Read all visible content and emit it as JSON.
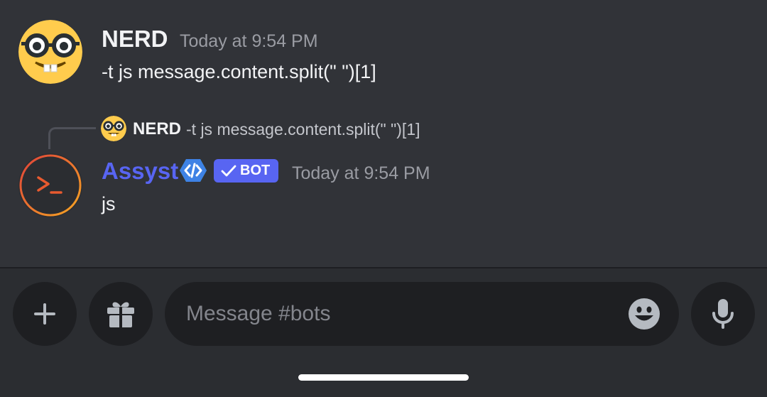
{
  "messages": [
    {
      "username": "NERD",
      "timestamp": "Today at 9:54 PM",
      "content": "-t js message.content.split(\" \")[1]",
      "avatar_icon": "nerd-face-emoji"
    },
    {
      "reply": {
        "username": "NERD",
        "content": "-t js message.content.split(\" \")[1]",
        "avatar_icon": "nerd-face-emoji"
      },
      "username": "Assyst",
      "badge_icon": "developer-code-badge-icon",
      "bot_tag": "BOT",
      "timestamp": "Today at 9:54 PM",
      "content": "js",
      "avatar_icon": "terminal-prompt-icon"
    }
  ],
  "composer": {
    "placeholder": "Message #bots",
    "buttons": [
      "plus-icon",
      "gift-icon",
      "emoji-icon",
      "microphone-icon"
    ]
  },
  "colors": {
    "background": "#313338",
    "composer_background": "#2b2d31",
    "input_background": "#1e1f22",
    "bot_name": "#5865f2",
    "bot_tag": "#5865f2",
    "timestamp": "#9a9ca3"
  }
}
